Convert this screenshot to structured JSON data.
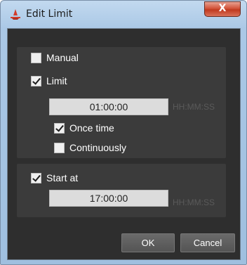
{
  "window": {
    "title": "Edit Limit",
    "close_label": "X"
  },
  "options": {
    "manual": {
      "label": "Manual",
      "checked": false
    },
    "limit": {
      "label": "Limit",
      "checked": true,
      "value": "01:00:00",
      "format_hint": "HH:MM:SS",
      "once_time": {
        "label": "Once time",
        "checked": true
      },
      "continuously": {
        "label": "Continuously",
        "checked": false
      }
    },
    "start_at": {
      "label": "Start at",
      "checked": true,
      "value": "17:00:00",
      "format_hint": "HH:MM:SS"
    }
  },
  "buttons": {
    "ok": "OK",
    "cancel": "Cancel"
  },
  "icons": {
    "app": "red-cone-icon",
    "close": "close-icon"
  }
}
